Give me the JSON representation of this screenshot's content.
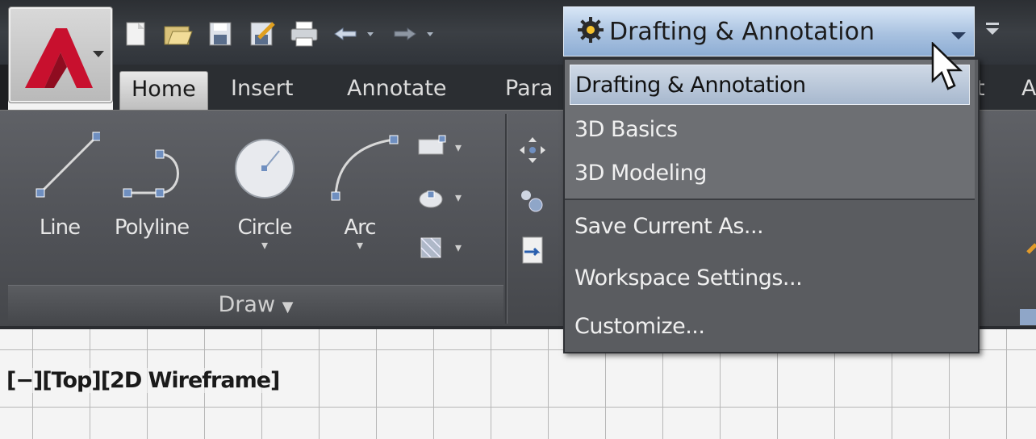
{
  "quick_access": {
    "icons": [
      "new-icon",
      "open-icon",
      "save-icon",
      "save-as-icon",
      "plot-icon",
      "undo-icon",
      "redo-icon"
    ]
  },
  "workspace": {
    "current": "Drafting & Annotation",
    "menu_items": [
      "Drafting & Annotation",
      "3D Basics",
      "3D Modeling",
      "Save Current As...",
      "Workspace Settings...",
      "Customize..."
    ]
  },
  "tabs": [
    "Home",
    "Insert",
    "Annotate",
    "Para",
    "t",
    "A"
  ],
  "draw_panel": {
    "title": "Draw",
    "tools": [
      "Line",
      "Polyline",
      "Circle",
      "Arc"
    ]
  },
  "viewport": {
    "label": "[−][Top][2D Wireframe]"
  },
  "colors": {
    "accent_red": "#c8102e",
    "selection_blue": "#a9c2e0",
    "ribbon_bg": "#4f5156"
  }
}
